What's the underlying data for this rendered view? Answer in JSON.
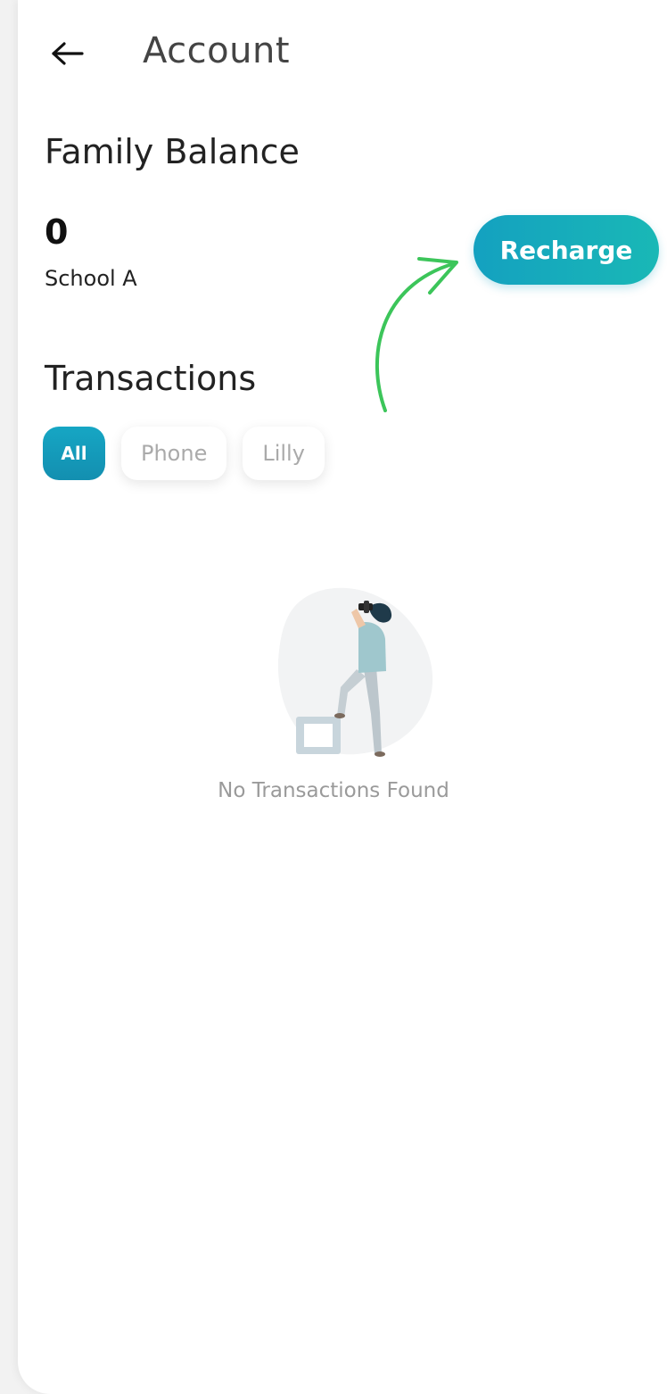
{
  "header": {
    "back_icon": "arrow-left-icon",
    "title": "Account"
  },
  "balance": {
    "section_title": "Family Balance",
    "amount": "0",
    "school": "School A",
    "recharge_label": "Recharge"
  },
  "transactions": {
    "section_title": "Transactions",
    "filters": [
      {
        "label": "All",
        "active": true
      },
      {
        "label": "Phone",
        "active": false
      },
      {
        "label": "Lilly",
        "active": false
      }
    ],
    "empty_text": "No Transactions Found"
  },
  "colors": {
    "accent_start": "#14a1c0",
    "accent_end": "#19b8b6",
    "annotation_arrow": "#3cc55a"
  }
}
